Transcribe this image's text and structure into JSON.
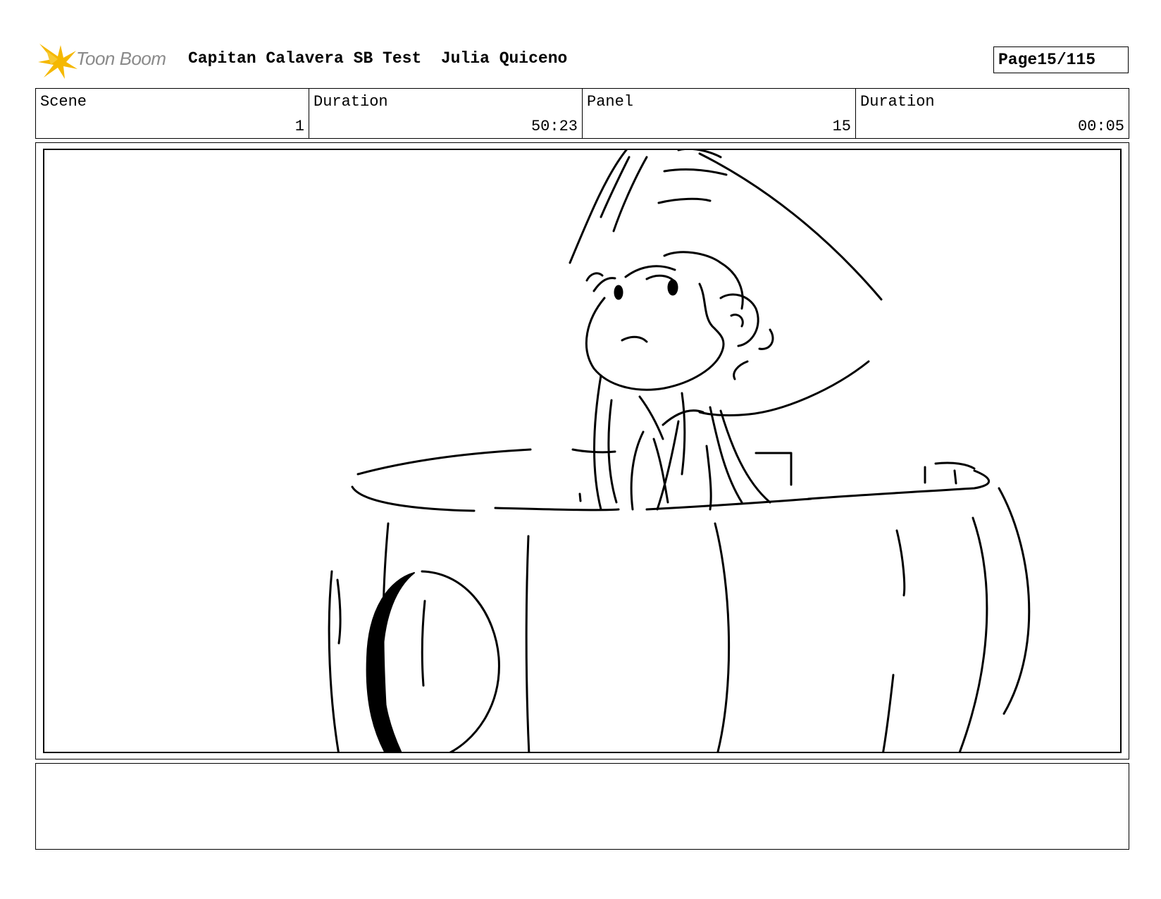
{
  "header": {
    "logo_text": "Toon Boom",
    "project_title": "Capitan Calavera SB Test",
    "author": "Julia Quiceno",
    "page_label": "Page",
    "page_value": "15/115"
  },
  "info": {
    "scene_label": "Scene",
    "scene_value": "1",
    "scene_duration_label": "Duration",
    "scene_duration_value": "50:23",
    "panel_label": "Panel",
    "panel_value": "15",
    "panel_duration_label": "Duration",
    "panel_duration_value": "00:05"
  },
  "notes": {
    "text": ""
  },
  "colors": {
    "logo_accent": "#f5b800",
    "logo_text": "#8a8a8a"
  }
}
